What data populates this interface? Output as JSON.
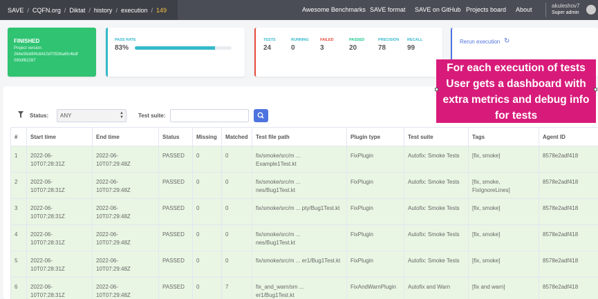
{
  "nav": {
    "breadcrumbs": [
      "SAVE",
      "CQFN.org",
      "Diktat",
      "history",
      "execution"
    ],
    "execution_id": "149",
    "separator": "/",
    "links": [
      "Awesome Benchmarks",
      "SAVE format",
      "SAVE on GitHub",
      "Projects board",
      "About"
    ],
    "user_name": "akuleshov7",
    "user_role": "Super admin"
  },
  "status_card": {
    "title": "FINISHED",
    "version_label": "Project version:",
    "version_line1": "264e5feb9f4c6410d70536a6fc4bdf",
    "version_line2": "090df62287"
  },
  "pass_card": {
    "label": "PASS RATE",
    "value": "83%",
    "rate": 0.83
  },
  "metrics": [
    {
      "label": "TESTS",
      "value": "24",
      "color": "#36b9cc"
    },
    {
      "label": "RUNNING",
      "value": "0",
      "color": "#36b9cc"
    },
    {
      "label": "FAILED",
      "value": "3",
      "color": "#e74a3b"
    },
    {
      "label": "PASSED",
      "value": "20",
      "color": "#1cc88a"
    },
    {
      "label": "PRECISION",
      "value": "78",
      "color": "#36b9cc"
    },
    {
      "label": "RECALL",
      "value": "99",
      "color": "#36b9cc"
    }
  ],
  "rerun": {
    "label": "Rerun execution",
    "icon": "refresh-icon"
  },
  "overlay": [
    "For each execution of tests",
    "User gets a dashboard with",
    "extra metrics and debug info",
    "for tests"
  ],
  "filter": {
    "status_label": "Status:",
    "status_value": "ANY",
    "suite_label": "Test suite:",
    "suite_value": ""
  },
  "table": {
    "columns": [
      "#",
      "Start time",
      "End time",
      "Status",
      "Missing",
      "Matched",
      "Test file path",
      "Plugin type",
      "Test suite",
      "Tags",
      "Agent ID"
    ],
    "rows": [
      [
        "1",
        "2022-06-\n10T07:28:31Z",
        "2022-06-\n10T07:29:48Z",
        "PASSED",
        "0",
        "0",
        "fix/smoke/src/m ...\nExample1Test.kt",
        "FixPlugin",
        "Autofix: Smoke Tests",
        "[fix, smoke]",
        "8578e2adf418"
      ],
      [
        "2",
        "2022-06-\n10T07:28:31Z",
        "2022-06-\n10T07:29:48Z",
        "PASSED",
        "0",
        "0",
        "fix/smoke/src/m ...\nnes/Bug1Test.kt",
        "FixPlugin",
        "Autofix: Smoke Tests",
        "[fix, smoke,\nFixIgnoreLines]",
        "8578e2adf418"
      ],
      [
        "3",
        "2022-06-\n10T07:28:31Z",
        "2022-06-\n10T07:29:48Z",
        "PASSED",
        "0",
        "0",
        "fix/smoke/src/m ... pty/Bug1Test.kt",
        "FixPlugin",
        "Autofix: Smoke Tests",
        "[fix, smoke]",
        "8578e2adf418"
      ],
      [
        "4",
        "2022-06-\n10T07:28:31Z",
        "2022-06-\n10T07:29:48Z",
        "PASSED",
        "0",
        "0",
        "fix/smoke/src/m ...\nnes/Bug1Test.kt",
        "FixPlugin",
        "Autofix: Smoke Tests",
        "[fix, smoke]",
        "8578e2adf418"
      ],
      [
        "5",
        "2022-06-\n10T07:28:31Z",
        "2022-06-\n10T07:29:48Z",
        "PASSED",
        "0",
        "0",
        "fix/smoke/src/m ... er1/Bug1Test.kt",
        "FixPlugin",
        "Autofix: Smoke Tests",
        "[fix, smoke]",
        "8578e2adf418"
      ],
      [
        "6",
        "2022-06-\n10T07:28:31Z",
        "2022-06-\n10T07:29:48Z",
        "PASSED",
        "0",
        "7",
        "fix_and_warn/sm ...\ner1/Bug1Test.kt",
        "FixAndWarnPlugin",
        "Autofix and Warn",
        "[fix and warn]",
        "8578e2adf418"
      ]
    ]
  }
}
